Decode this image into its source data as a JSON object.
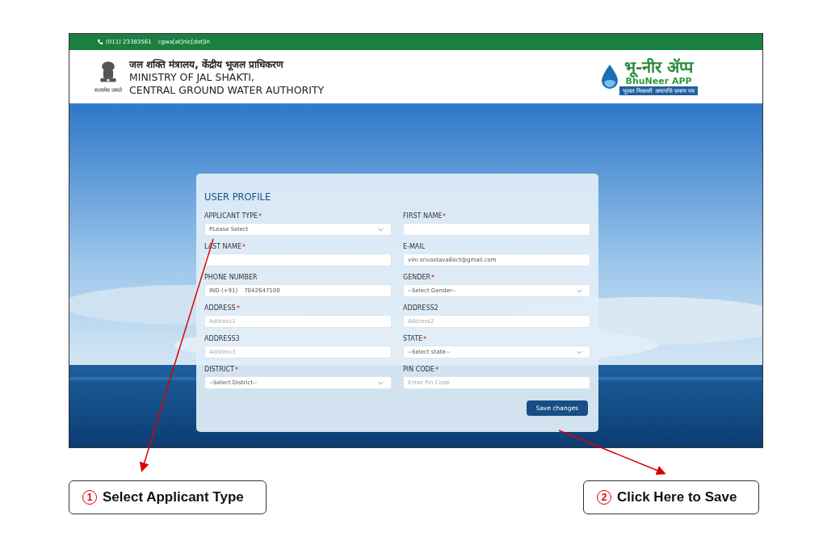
{
  "top_bar": {
    "phone": "(011) 23383561",
    "email": "cgwa[at]nic[dot]in"
  },
  "header": {
    "emblem_motto": "सत्यमेव जयते",
    "hindi_title": "जल शक्ति मंत्रालय, केंद्रीय भूजल प्राधिकरण",
    "title_lines": [
      "MINISTRY OF JAL SHAKTI,",
      "CENTRAL GROUND WATER AUTHORITY"
    ],
    "logo": {
      "hindi_name": "भू-नीर ॲप्प",
      "name": "BhuNeer APP",
      "tagline": "भूजल निकासी अनापत्ति प्रमाण पत्र"
    }
  },
  "form": {
    "title": "USER PROFILE",
    "fields": [
      {
        "label": "APPLICANT TYPE",
        "required": true,
        "kind": "select",
        "value": "PLease Select"
      },
      {
        "label": "FIRST NAME",
        "required": true,
        "kind": "text"
      },
      {
        "label": "LAST NAME",
        "required": true,
        "kind": "text"
      },
      {
        "label": "E-MAIL",
        "required": false,
        "kind": "text",
        "value": "vini.srivastava6oct@gmail.com"
      },
      {
        "label": "PHONE NUMBER",
        "required": false,
        "kind": "phone",
        "prefix": "IND (+91)",
        "value": "7042647100"
      },
      {
        "label": "GENDER",
        "required": true,
        "kind": "select",
        "value": "--Select Gender--"
      },
      {
        "label": "ADDRESS",
        "required": true,
        "kind": "text",
        "placeholder": "Address1"
      },
      {
        "label": "ADDRESS2",
        "required": false,
        "kind": "text",
        "placeholder": "Address2"
      },
      {
        "label": "ADDRESS3",
        "required": false,
        "kind": "text",
        "placeholder": "Address3"
      },
      {
        "label": "STATE",
        "required": true,
        "kind": "select",
        "value": "--Select state--"
      },
      {
        "label": "DISTRICT",
        "required": true,
        "kind": "select",
        "value": "--Select District--"
      },
      {
        "label": "PIN CODE",
        "required": true,
        "kind": "text",
        "placeholder": "Enter Pin Code"
      }
    ],
    "save_button": "Save changes"
  },
  "callouts": [
    {
      "number": "1",
      "text": "Select Applicant Type"
    },
    {
      "number": "2",
      "text": "Click Here to Save"
    }
  ]
}
